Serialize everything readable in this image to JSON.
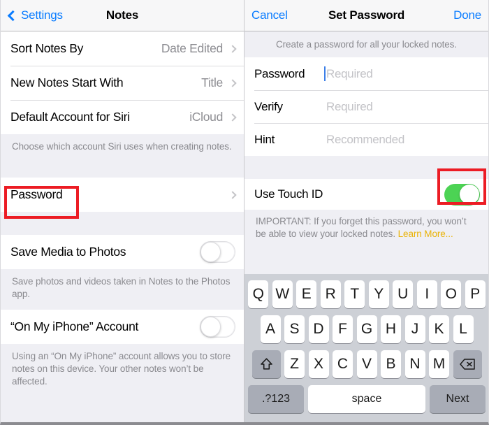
{
  "left_panel": {
    "navbar": {
      "back_label": "Settings",
      "title": "Notes"
    },
    "section1": [
      {
        "label": "Sort Notes By",
        "value": "Date Edited"
      },
      {
        "label": "New Notes Start With",
        "value": "Title"
      },
      {
        "label": "Default Account for Siri",
        "value": "iCloud"
      }
    ],
    "note1": "Choose which account Siri uses when creating notes.",
    "password_row": {
      "label": "Password"
    },
    "media_row": {
      "label": "Save Media to Photos",
      "toggle_state": "off"
    },
    "note2": "Save photos and videos taken in Notes to the Photos app.",
    "account_row": {
      "label": "“On My iPhone” Account",
      "toggle_state": "off"
    },
    "note3": "Using an “On My iPhone” account allows you to store notes on this device. Your other notes won’t be affected."
  },
  "right_panel": {
    "navbar": {
      "cancel_label": "Cancel",
      "title": "Set Password",
      "done_label": "Done"
    },
    "header_note": "Create a password for all your locked notes.",
    "fields": [
      {
        "label": "Password",
        "placeholder": "Required",
        "focused": true
      },
      {
        "label": "Verify",
        "placeholder": "Required",
        "focused": false
      },
      {
        "label": "Hint",
        "placeholder": "Recommended",
        "focused": false
      }
    ],
    "touch_id": {
      "label": "Use Touch ID",
      "toggle_state": "on"
    },
    "important_text": "IMPORTANT: If you forget this password, you won’t be able to view your locked notes. ",
    "learn_more_label": "Learn More...",
    "keyboard": {
      "row1": [
        "Q",
        "W",
        "E",
        "R",
        "T",
        "Y",
        "U",
        "I",
        "O",
        "P"
      ],
      "row2": [
        "A",
        "S",
        "D",
        "F",
        "G",
        "H",
        "J",
        "K",
        "L"
      ],
      "row3": [
        "Z",
        "X",
        "C",
        "V",
        "B",
        "N",
        "M"
      ],
      "shift_key": "shift-icon",
      "delete_key": "delete-icon",
      "numbers_key": ".?123",
      "space_key": "space",
      "next_key": "Next"
    }
  },
  "colors": {
    "accent_blue": "#0a7cff",
    "toggle_on_green": "#4cd354",
    "highlight_red": "#ec1c24",
    "learn_more_amber": "#eab308"
  }
}
